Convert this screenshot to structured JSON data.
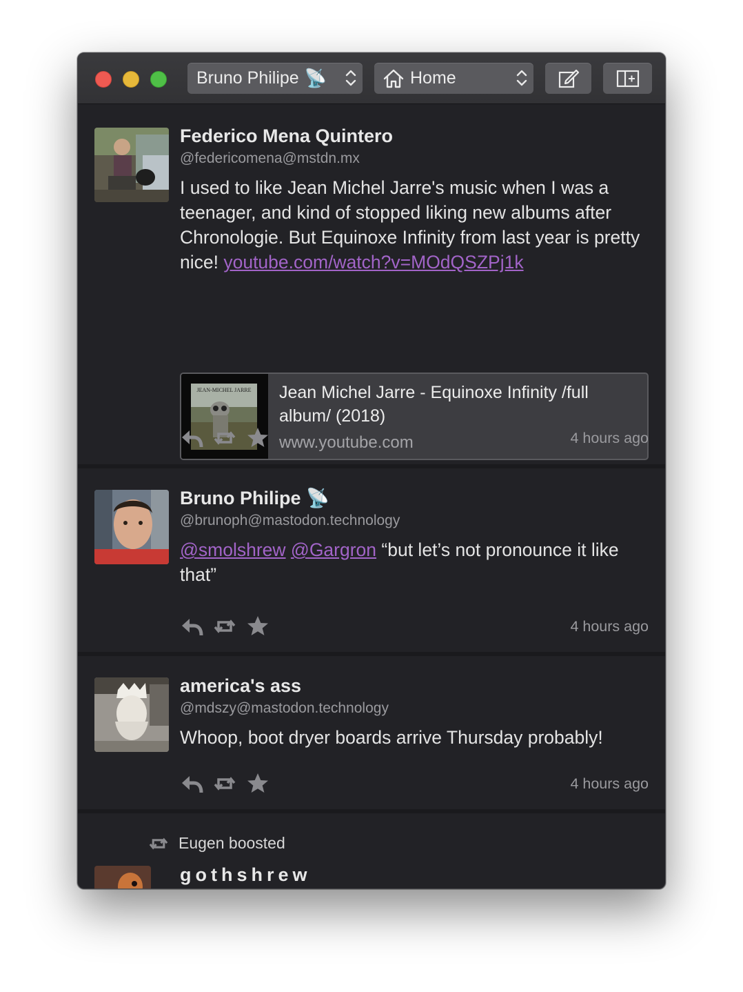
{
  "toolbar": {
    "account_name": "Bruno Philipe",
    "account_emoji": "📡",
    "timeline_label": "Home"
  },
  "statuses": [
    {
      "name": "Federico Mena Quintero",
      "handle": "@federicomena@mstdn.mx",
      "text": "I used to like Jean Michel Jarre's music when I was a teenager, and kind of stopped liking new albums after Chronologie.  But Equinoxe Infinity from last year is pretty nice! ",
      "link": "youtube.com/watch?v=MOdQSZPj1k",
      "card": {
        "title": "Jean Michel Jarre - Equinoxe Infinity /full album/ (2018)",
        "url": "www.youtube.com",
        "thumb_caption": "JEAN-MICHEL JARRE"
      },
      "time": "4 hours ago"
    },
    {
      "name": "Bruno Philipe",
      "emoji": "📡",
      "handle": "@brunoph@mastodon.technology",
      "mention1": "@smolshrew",
      "mention2": "@Gargron",
      "text": " “but let’s not pronounce it like that”",
      "time": "4 hours ago"
    },
    {
      "name": "america's ass",
      "handle": "@mdszy@mastodon.technology",
      "text": "Whoop, boot dryer boards arrive Thursday probably!",
      "time": "4 hours ago"
    },
    {
      "boosted_by": "Eugen boosted",
      "name": "gothshrew"
    }
  ],
  "colors": {
    "background": "#222226",
    "link": "#a264c8",
    "text": "#e4e4e4",
    "muted": "#9a9a9e"
  },
  "icons": [
    "reply-icon",
    "boost-icon",
    "favourite-icon",
    "home-icon",
    "compose-icon",
    "sidebar-icon"
  ]
}
